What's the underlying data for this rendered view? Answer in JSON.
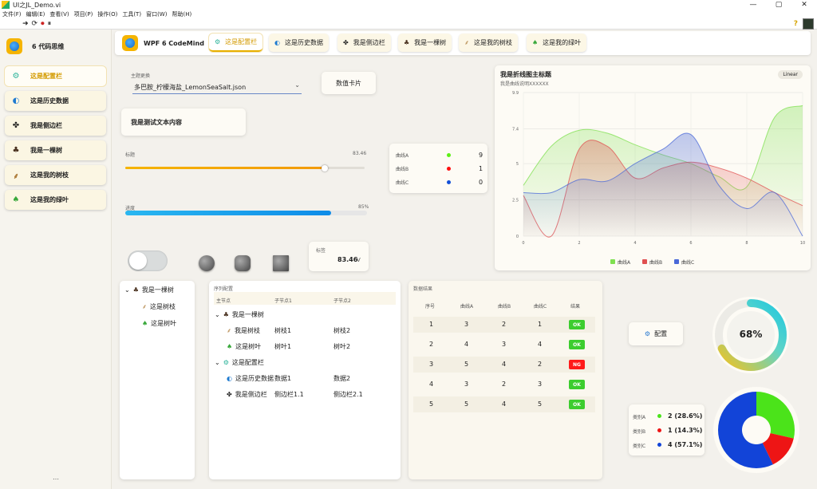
{
  "window": {
    "title": "UI之JL_Demo.vi",
    "controls": [
      "—",
      "▢",
      "✕"
    ]
  },
  "menu": [
    "文件(F)",
    "编辑(E)",
    "查看(V)",
    "项目(P)",
    "操作(O)",
    "工具(T)",
    "窗口(W)",
    "帮助(H)"
  ],
  "toolstrip": {
    "run": "➜",
    "run_cont": "⟳",
    "abort": "⏺",
    "pause": "⏸",
    "help": "?"
  },
  "sidebar": {
    "brand": "6 代码思维",
    "items": [
      {
        "label": "这是配置栏",
        "icon": "⚙"
      },
      {
        "label": "这是历史数据",
        "icon": "◐"
      },
      {
        "label": "我是侧边栏",
        "icon": "✤"
      },
      {
        "label": "我是一棵树",
        "icon": "♣"
      },
      {
        "label": "这是我的树枝",
        "icon": "⸙"
      },
      {
        "label": "这是我的绿叶",
        "icon": "♠"
      }
    ],
    "collapse": "…"
  },
  "header": {
    "brand": "WPF 6 CodeMind",
    "tabs": [
      {
        "label": "这是配置栏",
        "icon": "⚙"
      },
      {
        "label": "这是历史数据",
        "icon": "◐"
      },
      {
        "label": "我是侧边栏",
        "icon": "✤"
      },
      {
        "label": "我是一棵树",
        "icon": "♣"
      },
      {
        "label": "这是我的树枝",
        "icon": "⸙"
      },
      {
        "label": "这是我的绿叶",
        "icon": "♠"
      }
    ]
  },
  "theme_select": {
    "caption": "主题更换",
    "value": "多巴胺_柠檬海盐_LemonSeaSalt.json",
    "chevron": "⌄"
  },
  "card_button": "数值卡片",
  "text_display": "我是测试文本内容",
  "slider": {
    "caption": "标题",
    "value_text": "83.46",
    "fraction": 0.8346
  },
  "progress": {
    "caption": "进度",
    "percent_text": "85%",
    "fraction": 0.85
  },
  "mini_legend": [
    {
      "name": "曲线A",
      "value": "9",
      "color": "#5df015"
    },
    {
      "name": "曲线B",
      "value": "1",
      "color": "#ff1010"
    },
    {
      "name": "曲线C",
      "value": "0",
      "color": "#1450d8"
    }
  ],
  "numeric_card": {
    "caption": "标签",
    "value": "83.46",
    "unit": "V"
  },
  "chart": {
    "title": "我是折线图主标题",
    "subtitle": "我是曲线说明XXXXXX",
    "mode": "Linear"
  },
  "chart_data": {
    "type": "area",
    "title": "我是折线图主标题",
    "subtitle": "我是曲线说明XXXXXX",
    "xlim": [
      0,
      10
    ],
    "ylim": [
      0,
      9.9
    ],
    "xticks": [
      "0",
      "2",
      "4",
      "6",
      "8",
      "10"
    ],
    "yticks": [
      "0",
      "2.5",
      "5",
      "7.4",
      "9.9"
    ],
    "x": [
      0,
      1,
      2,
      3,
      4,
      5,
      6,
      7,
      8,
      9,
      10
    ],
    "series": [
      {
        "name": "曲线A",
        "color": "#7fe050",
        "values": [
          3.5,
          6.2,
          7.3,
          7.1,
          6.3,
          5.6,
          5.0,
          4.1,
          3.4,
          8.2,
          9.0
        ]
      },
      {
        "name": "曲线B",
        "color": "#e05050",
        "values": [
          2.8,
          0.0,
          6.0,
          6.2,
          4.0,
          4.7,
          5.1,
          4.7,
          4.0,
          3.0,
          2.1
        ]
      },
      {
        "name": "曲线C",
        "color": "#4a68d8",
        "values": [
          3.0,
          3.0,
          3.9,
          3.8,
          5.0,
          6.0,
          7.0,
          3.5,
          1.9,
          3.0,
          0.0
        ]
      }
    ],
    "legend": "bottom",
    "grid": true
  },
  "tree": {
    "root": "我是一棵树",
    "children": [
      "这是树枝",
      "这是树叶"
    ],
    "collapse_icon": "⌄"
  },
  "tree_table": {
    "caption": "序列配置",
    "headers": [
      "主节点",
      "子节点1",
      "子节点2"
    ],
    "groups": [
      {
        "label": "我是一棵树",
        "icon": "♣",
        "rows": [
          {
            "label": "我是树枝",
            "icon": "⸙",
            "c1": "树枝1",
            "c2": "树枝2"
          },
          {
            "label": "这是树叶",
            "icon": "♠",
            "c1": "树叶1",
            "c2": "树叶2"
          }
        ]
      },
      {
        "label": "这是配置栏",
        "icon": "⚙",
        "rows": [
          {
            "label": "这是历史数据",
            "icon": "◐",
            "c1": "数据1",
            "c2": "数据2"
          },
          {
            "label": "我是侧边栏",
            "icon": "✤",
            "c1": "侧边栏1.1",
            "c2": "侧边栏2.1"
          }
        ]
      }
    ]
  },
  "data_table": {
    "caption": "数据结果",
    "headers": [
      "序号",
      "曲线A",
      "曲线B",
      "曲线C",
      "结果"
    ],
    "rows": [
      [
        "1",
        "3",
        "2",
        "1",
        "OK"
      ],
      [
        "2",
        "4",
        "3",
        "4",
        "OK"
      ],
      [
        "3",
        "5",
        "4",
        "2",
        "NG"
      ],
      [
        "4",
        "3",
        "2",
        "3",
        "OK"
      ],
      [
        "5",
        "5",
        "4",
        "5",
        "OK"
      ]
    ],
    "ok_color": "#3ccd2e",
    "ng_color": "#ff1a1a"
  },
  "config_button": {
    "label": "配置",
    "icon": "⚙"
  },
  "gauge": {
    "text": "68%",
    "fraction": 0.68
  },
  "pie": {
    "items": [
      {
        "name": "类别A",
        "value_text": "2 (28.6%)",
        "value": 2,
        "color": "#4be31a"
      },
      {
        "name": "类别B",
        "value_text": "1 (14.3%)",
        "value": 1,
        "color": "#ee1515"
      },
      {
        "name": "类别C",
        "value_text": "4 (57.1%)",
        "value": 4,
        "color": "#1244d8"
      }
    ]
  }
}
